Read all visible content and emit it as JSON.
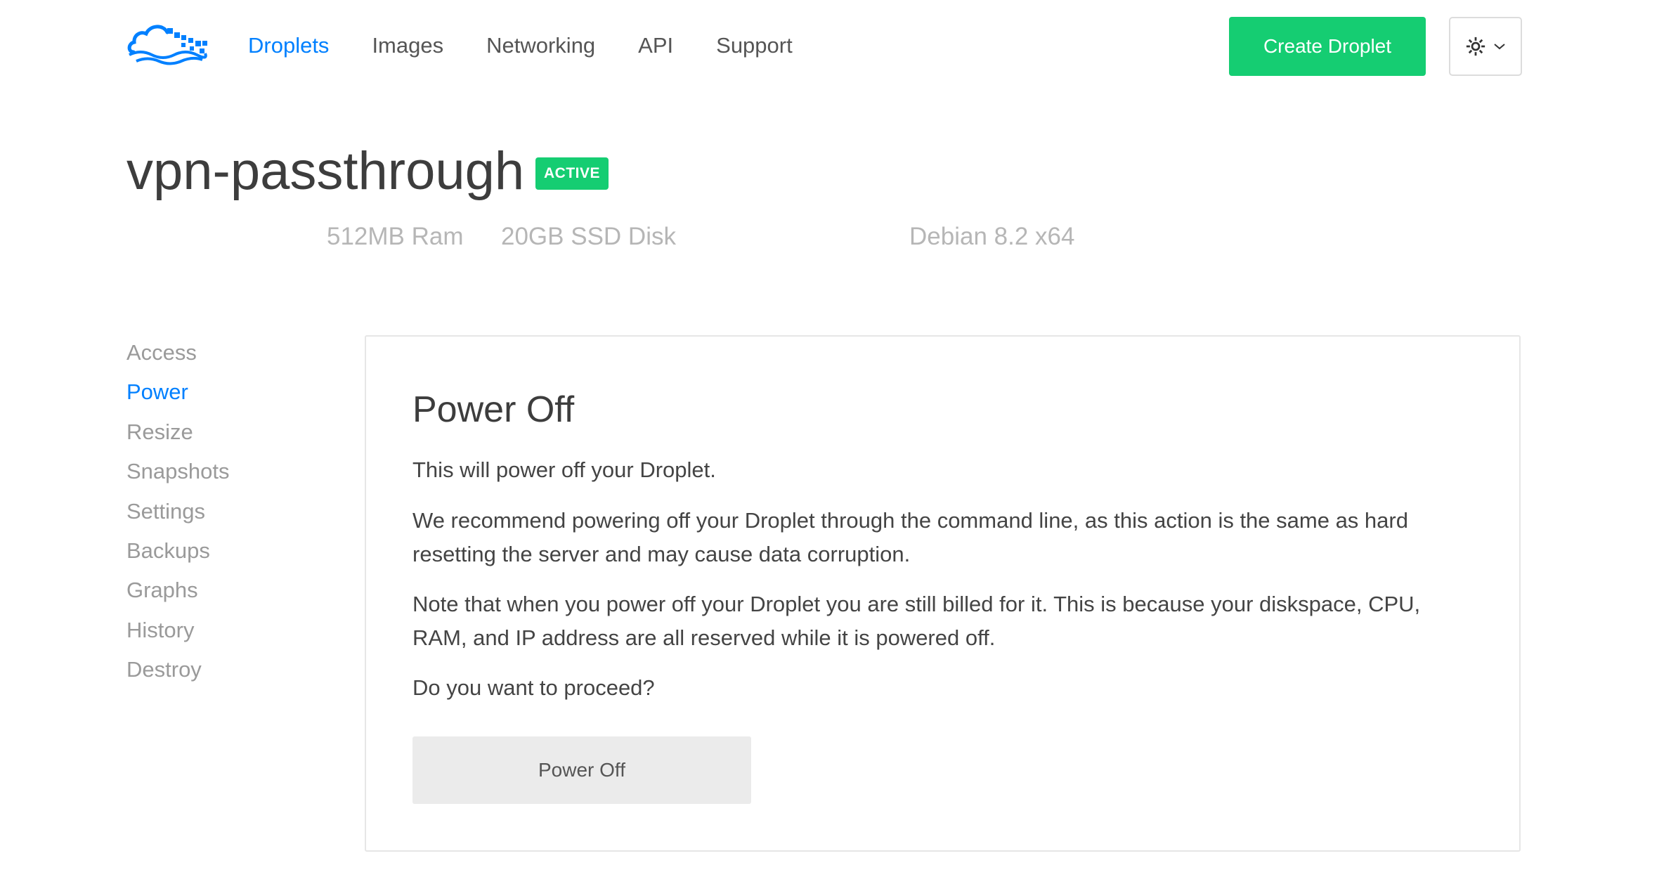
{
  "colors": {
    "accent": "#0080ff",
    "success": "#15cd72",
    "muted": "#b6b6b6"
  },
  "header": {
    "logo": "digitalocean-cloud-logo",
    "nav": [
      {
        "label": "Droplets",
        "active": true
      },
      {
        "label": "Images",
        "active": false
      },
      {
        "label": "Networking",
        "active": false
      },
      {
        "label": "API",
        "active": false
      },
      {
        "label": "Support",
        "active": false
      }
    ],
    "create_label": "Create Droplet",
    "settings_icons": [
      "gear-icon",
      "chevron-down-icon"
    ]
  },
  "droplet": {
    "name": "vpn-passthrough",
    "status": "ACTIVE",
    "ram": "512MB Ram",
    "disk": "20GB SSD Disk",
    "os": "Debian 8.2 x64"
  },
  "sidebar": {
    "items": [
      {
        "label": "Access",
        "active": false
      },
      {
        "label": "Power",
        "active": true
      },
      {
        "label": "Resize",
        "active": false
      },
      {
        "label": "Snapshots",
        "active": false
      },
      {
        "label": "Settings",
        "active": false
      },
      {
        "label": "Backups",
        "active": false
      },
      {
        "label": "Graphs",
        "active": false
      },
      {
        "label": "History",
        "active": false
      },
      {
        "label": "Destroy",
        "active": false
      }
    ]
  },
  "panel": {
    "title": "Power Off",
    "paragraphs": [
      "This will power off your Droplet.",
      "We recommend powering off your Droplet through the command line, as this action is the same as hard resetting the server and may cause data corruption.",
      "Note that when you power off your Droplet you are still billed for it. This is because your diskspace, CPU, RAM, and IP address are all reserved while it is powered off.",
      "Do you want to proceed?"
    ],
    "button_label": "Power Off"
  }
}
